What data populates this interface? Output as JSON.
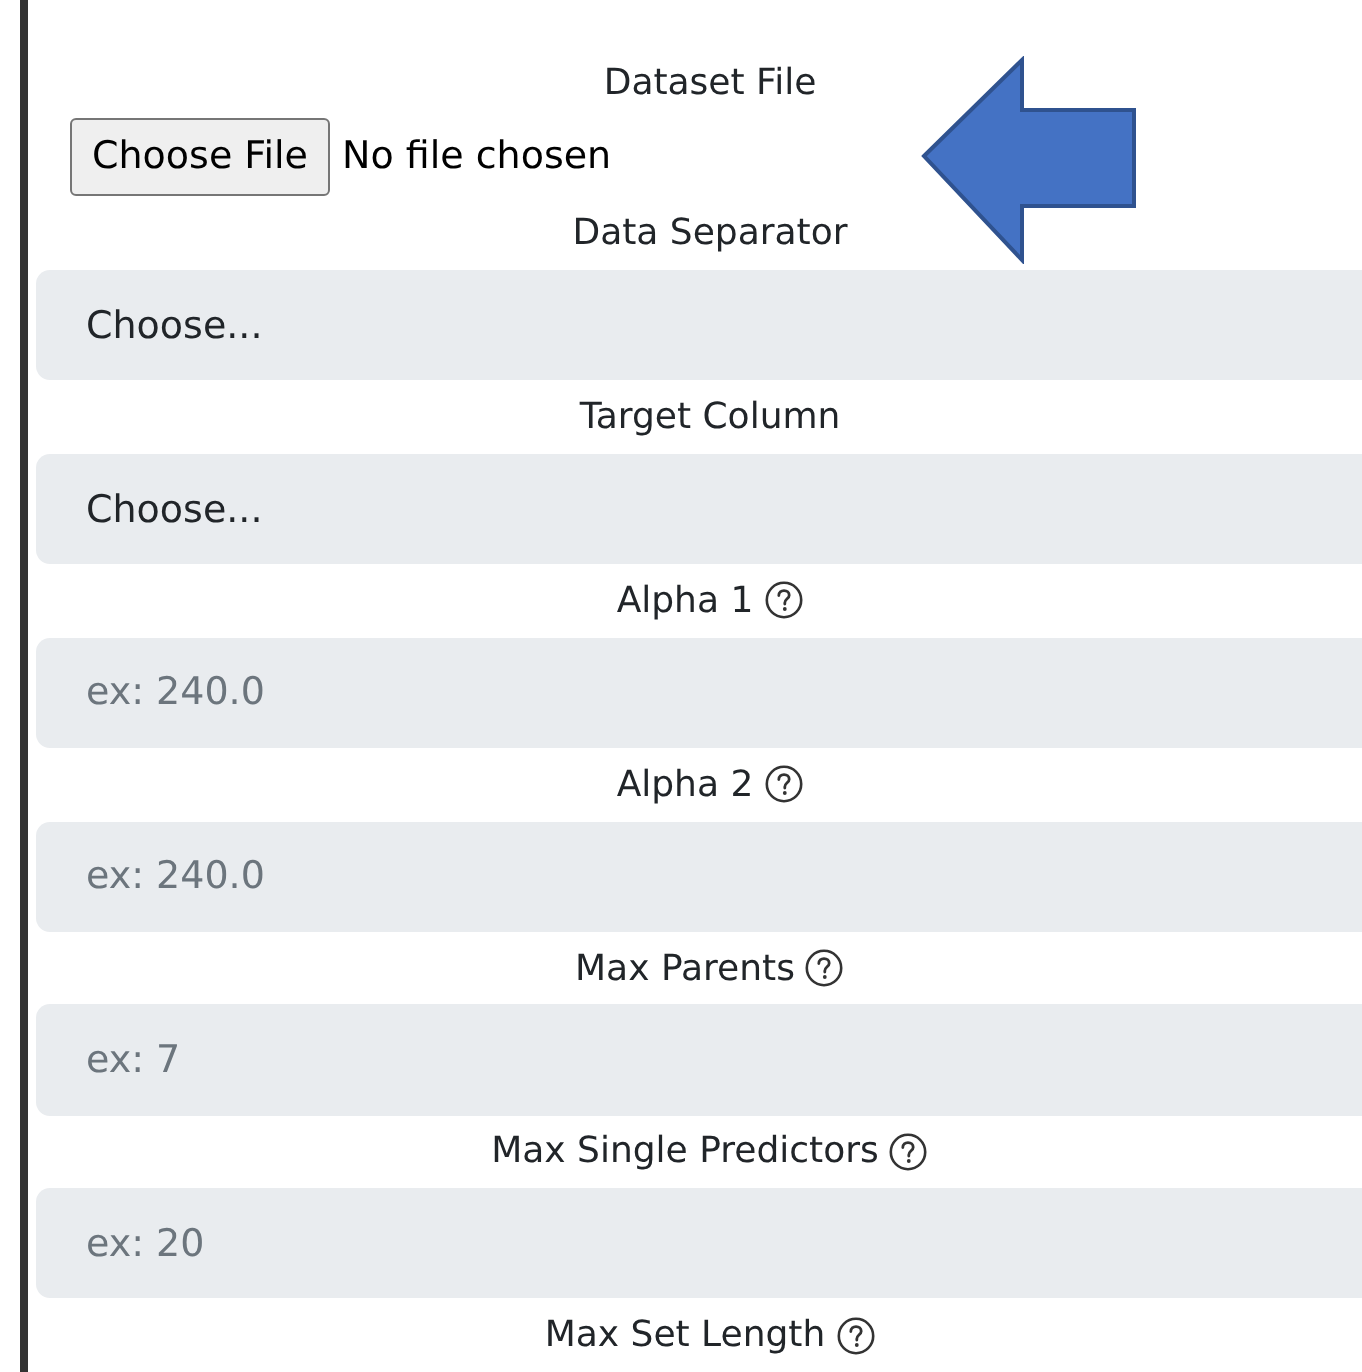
{
  "file_input": {
    "label": "Dataset File",
    "button": "Choose File",
    "status": "No file chosen"
  },
  "fields": [
    {
      "label": "Data Separator",
      "kind": "select",
      "value": "Choose...",
      "help": false
    },
    {
      "label": "Target Column",
      "kind": "select",
      "value": "Choose...",
      "help": false
    },
    {
      "label": "Alpha 1",
      "kind": "input",
      "placeholder": "ex: 240.0",
      "help": true
    },
    {
      "label": "Alpha 2",
      "kind": "input",
      "placeholder": "ex: 240.0",
      "help": true
    },
    {
      "label": "Max Parents",
      "kind": "input",
      "placeholder": "ex: 7",
      "help": true
    },
    {
      "label": "Max Single Predictors",
      "kind": "input",
      "placeholder": "ex: 20",
      "help": true
    },
    {
      "label": "Max Set Length",
      "kind": "label_only",
      "help": true
    }
  ]
}
